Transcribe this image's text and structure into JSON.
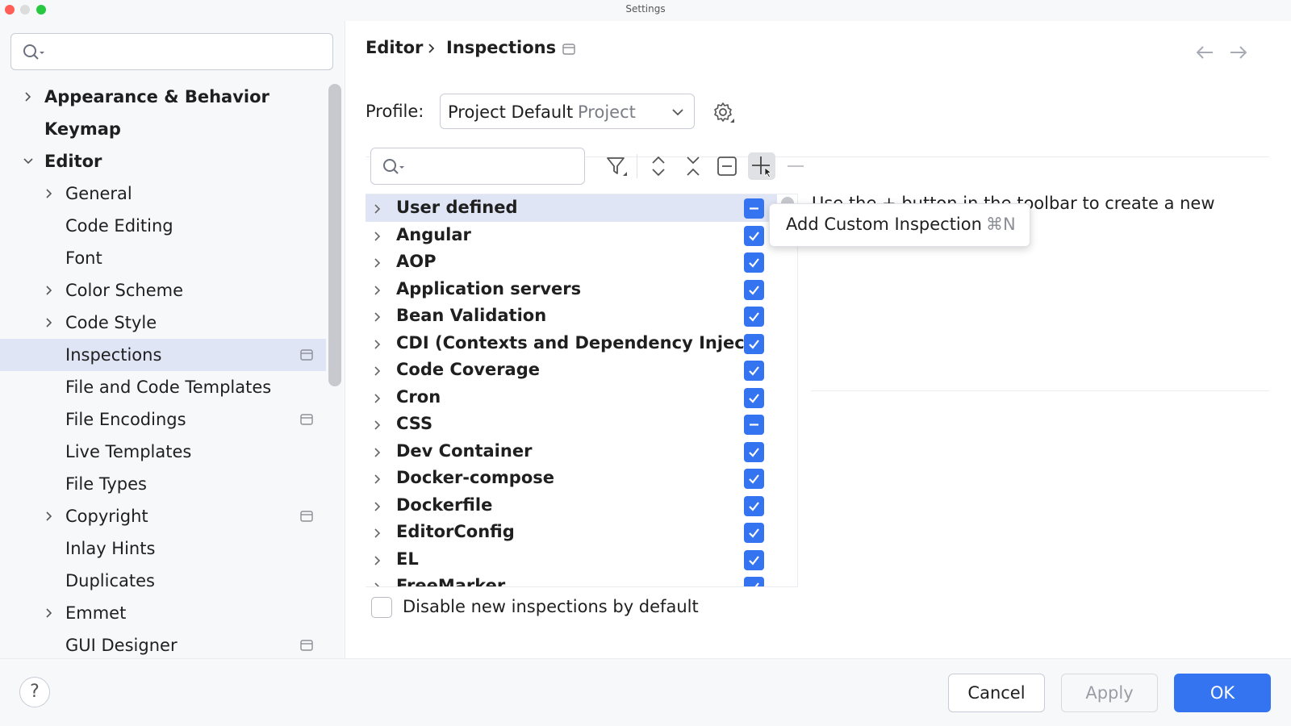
{
  "window": {
    "title": "Settings"
  },
  "sidebar": {
    "items": [
      {
        "label": "Appearance & Behavior",
        "level": 0,
        "bold": true,
        "expandable": true,
        "expanded": false
      },
      {
        "label": "Keymap",
        "level": 0,
        "bold": true,
        "expandable": false
      },
      {
        "label": "Editor",
        "level": 0,
        "bold": true,
        "expandable": true,
        "expanded": true
      },
      {
        "label": "General",
        "level": 1,
        "expandable": true
      },
      {
        "label": "Code Editing",
        "level": 1,
        "expandable": false
      },
      {
        "label": "Font",
        "level": 1,
        "expandable": false
      },
      {
        "label": "Color Scheme",
        "level": 1,
        "expandable": true
      },
      {
        "label": "Code Style",
        "level": 1,
        "expandable": true
      },
      {
        "label": "Inspections",
        "level": 1,
        "expandable": false,
        "selected": true,
        "project_icon": true
      },
      {
        "label": "File and Code Templates",
        "level": 1,
        "expandable": false
      },
      {
        "label": "File Encodings",
        "level": 1,
        "expandable": false,
        "project_icon": true
      },
      {
        "label": "Live Templates",
        "level": 1,
        "expandable": false
      },
      {
        "label": "File Types",
        "level": 1,
        "expandable": false
      },
      {
        "label": "Copyright",
        "level": 1,
        "expandable": true,
        "project_icon": true
      },
      {
        "label": "Inlay Hints",
        "level": 1,
        "expandable": false
      },
      {
        "label": "Duplicates",
        "level": 1,
        "expandable": false
      },
      {
        "label": "Emmet",
        "level": 1,
        "expandable": true
      },
      {
        "label": "GUI Designer",
        "level": 1,
        "expandable": false,
        "project_icon": true
      }
    ]
  },
  "breadcrumb": {
    "parent": "Editor",
    "current": "Inspections"
  },
  "profile": {
    "label": "Profile:",
    "name": "Project Default",
    "scope": "Project"
  },
  "inspections": {
    "rows": [
      {
        "label": "User defined",
        "state": "mixed",
        "selected": true
      },
      {
        "label": "Angular",
        "state": "checked"
      },
      {
        "label": "AOP",
        "state": "checked"
      },
      {
        "label": "Application servers",
        "state": "checked"
      },
      {
        "label": "Bean Validation",
        "state": "checked"
      },
      {
        "label": "CDI (Contexts and Dependency Injec",
        "state": "checked"
      },
      {
        "label": "Code Coverage",
        "state": "checked"
      },
      {
        "label": "Cron",
        "state": "checked"
      },
      {
        "label": "CSS",
        "state": "mixed"
      },
      {
        "label": "Dev Container",
        "state": "checked"
      },
      {
        "label": "Docker-compose",
        "state": "checked"
      },
      {
        "label": "Dockerfile",
        "state": "checked"
      },
      {
        "label": "EditorConfig",
        "state": "checked"
      },
      {
        "label": "EL",
        "state": "checked"
      },
      {
        "label": "FreeMarker",
        "state": "checked"
      }
    ]
  },
  "description": {
    "text": "Use the + button in the toolbar to create a new"
  },
  "popup": {
    "label": "Add Custom Inspection",
    "shortcut": "⌘N"
  },
  "options": {
    "disable_new_label": "Disable new inspections by default",
    "disable_new_checked": false
  },
  "footer": {
    "help": "?",
    "cancel": "Cancel",
    "apply": "Apply",
    "ok": "OK"
  },
  "colors": {
    "accent": "#3574f0",
    "selection": "#dfe5f5",
    "sidebar_bg": "#f7f8fa"
  }
}
